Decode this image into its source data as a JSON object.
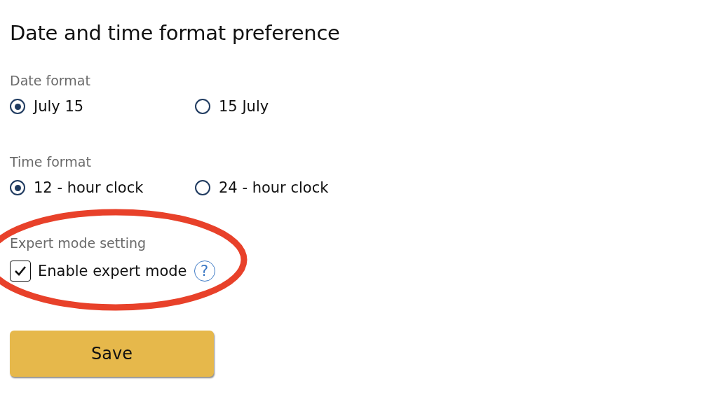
{
  "title": "Date and time format preference",
  "sections": [
    {
      "kind": "radio",
      "label": "Date format",
      "options": [
        {
          "label": "July 15",
          "selected": true
        },
        {
          "label": "15 July",
          "selected": false
        }
      ]
    },
    {
      "kind": "radio",
      "label": "Time format",
      "options": [
        {
          "label": "12 - hour clock",
          "selected": true
        },
        {
          "label": "24 - hour clock",
          "selected": false
        }
      ]
    },
    {
      "kind": "checkbox",
      "label": "Expert mode setting",
      "options": [
        {
          "label": "Enable expert mode",
          "checked": true,
          "help": "?"
        }
      ]
    }
  ],
  "save_button": "Save"
}
